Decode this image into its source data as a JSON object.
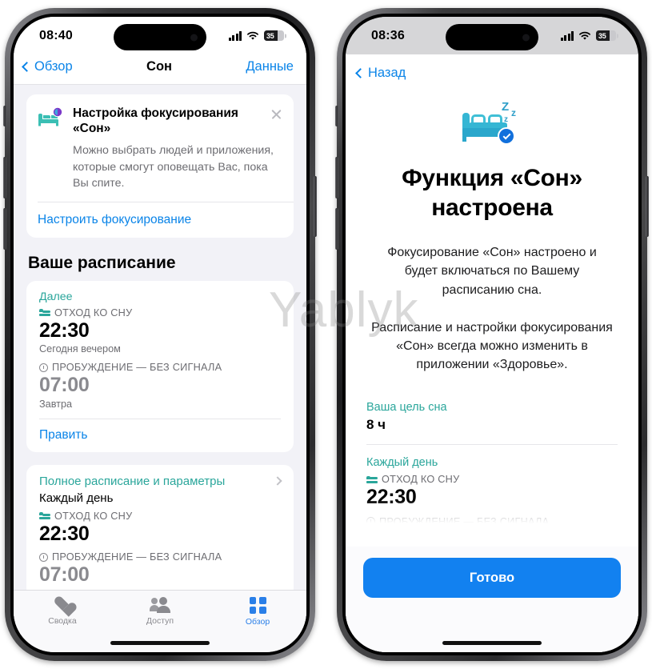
{
  "watermark": "Yablyk",
  "left_phone": {
    "status_bar": {
      "time": "08:40",
      "cellular_icon": "signal-bars-icon",
      "wifi_icon": "wifi-icon",
      "battery_level": "35"
    },
    "navbar": {
      "back_label": "Обзор",
      "title": "Сон",
      "right_label": "Данные"
    },
    "focus_banner": {
      "icon": "bed-clock-icon",
      "title": "Настройка фокусирования «Сон»",
      "description": "Можно выбрать людей и приложения, которые смогут оповещать Вас, пока Вы спите.",
      "action_label": "Настроить фокусирование",
      "close_icon": "close-icon"
    },
    "section_title": "Ваше расписание",
    "next_card": {
      "kicker": "Далее",
      "bedtime_label": "ОТХОД КО СНУ",
      "bedtime_value": "22:30",
      "bedtime_sub": "Сегодня вечером",
      "wake_label": "ПРОБУЖДЕНИЕ — БЕЗ СИГНАЛА",
      "wake_value": "07:00",
      "wake_sub": "Завтра",
      "edit_label": "Править"
    },
    "full_schedule_card": {
      "link_label": "Полное расписание и параметры",
      "chevron_icon": "chevron-right-icon",
      "subtitle": "Каждый день",
      "bedtime_label": "ОТХОД КО СНУ",
      "bedtime_value": "22:30",
      "wake_label": "ПРОБУЖДЕНИЕ — БЕЗ СИГНАЛА",
      "wake_value": "07:00"
    },
    "tabbar": [
      {
        "label": "Сводка",
        "icon": "heart-icon",
        "active": false
      },
      {
        "label": "Доступ",
        "icon": "people-icon",
        "active": false
      },
      {
        "label": "Обзор",
        "icon": "grid-icon",
        "active": true
      }
    ]
  },
  "right_phone": {
    "status_bar": {
      "time": "08:36",
      "cellular_icon": "signal-bars-icon",
      "wifi_icon": "wifi-icon",
      "battery_level": "35"
    },
    "navbar": {
      "back_label": "Назад"
    },
    "hero": {
      "icon": "bed-zzz-check-icon",
      "title": "Функция «Сон» настроена",
      "paragraph_1": "Фокусирование «Сон» настроено и будет включаться по Вашему расписанию сна.",
      "paragraph_2": "Расписание и настройки фокусирования «Сон» всегда можно изменить в приложении «Здоровье»."
    },
    "details": {
      "goal_kicker": "Ваша цель сна",
      "goal_value": "8 ч",
      "daily_kicker": "Каждый день",
      "bedtime_label": "ОТХОД КО СНУ",
      "bedtime_value": "22:30",
      "wake_label": "ПРОБУЖДЕНИЕ — БЕЗ СИГНАЛА"
    },
    "cta_label": "Готово"
  },
  "colors": {
    "teal": "#2aa69b",
    "blue": "#0a84e8",
    "cta_blue": "#1281f0",
    "bed_cyan": "#35b6d4",
    "gray_text": "#6d6d72"
  }
}
